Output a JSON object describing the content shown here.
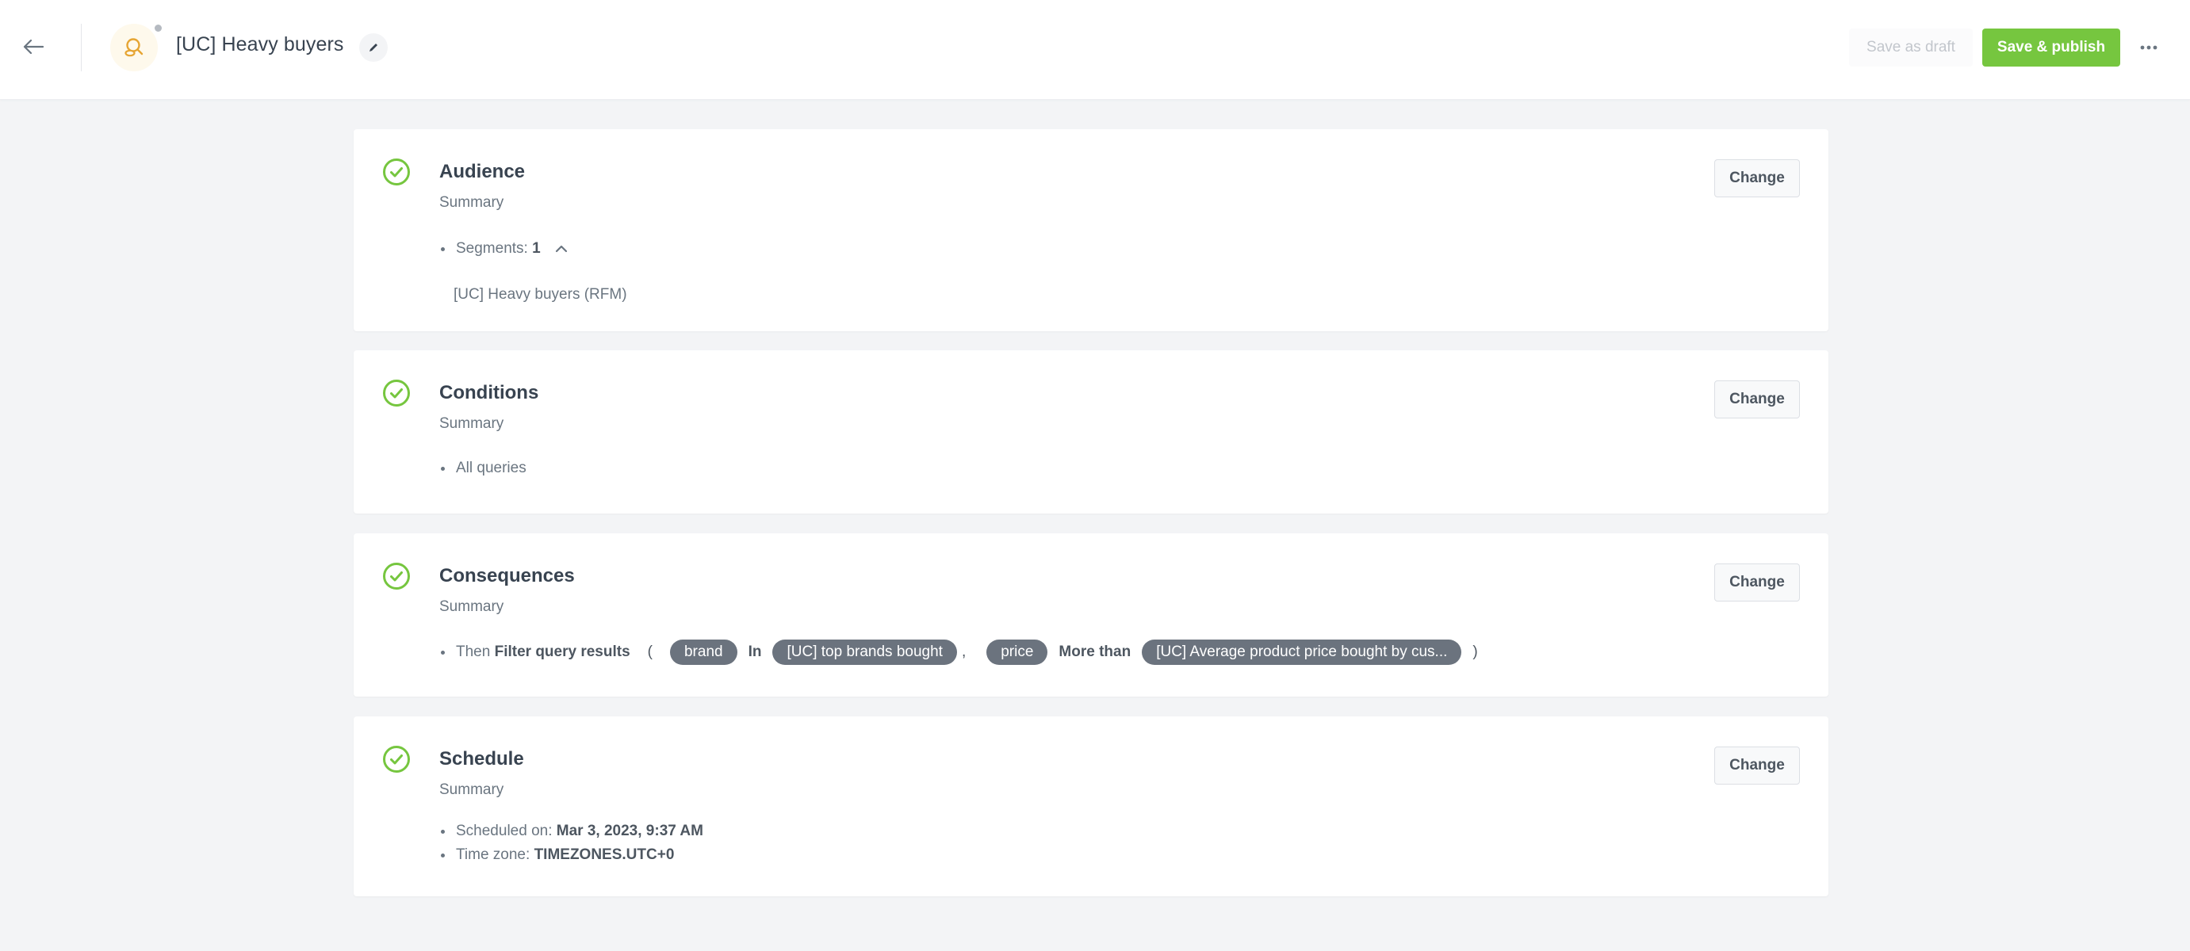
{
  "header": {
    "back_icon": "arrow-left-icon",
    "app_icon": "search-segment-icon",
    "title": "[UC] Heavy buyers",
    "edit_icon": "pencil-icon",
    "save_draft_label": "Save as draft",
    "publish_label": "Save & publish",
    "more_icon": "more-horizontal-icon",
    "colors": {
      "accent": "#76c63f",
      "app_icon_bg": "#fef9ec",
      "app_icon_fg": "#e6a533"
    }
  },
  "sections": {
    "audience": {
      "title": "Audience",
      "subtitle": "Summary",
      "change_label": "Change",
      "segments_label": "Segments:",
      "segments_count": "1",
      "segment_items": [
        "[UC] Heavy buyers (RFM)"
      ]
    },
    "conditions": {
      "title": "Conditions",
      "subtitle": "Summary",
      "change_label": "Change",
      "items": [
        "All queries"
      ]
    },
    "consequences": {
      "title": "Consequences",
      "subtitle": "Summary",
      "change_label": "Change",
      "then_label": "Then",
      "action": "Filter query results",
      "open_paren": "(",
      "close_paren": ")",
      "comma": ",",
      "filters": [
        {
          "field": "brand",
          "operator": "In",
          "value": "[UC] top brands bought"
        },
        {
          "field": "price",
          "operator": "More than",
          "value": "[UC] Average product price bought by cus..."
        }
      ]
    },
    "schedule": {
      "title": "Schedule",
      "subtitle": "Summary",
      "change_label": "Change",
      "scheduled_label": "Scheduled on:",
      "scheduled_value": "Mar 3, 2023, 9:37 AM",
      "timezone_label": "Time zone:",
      "timezone_value": "TIMEZONES.UTC+0"
    }
  },
  "status_color": "#76c63f"
}
